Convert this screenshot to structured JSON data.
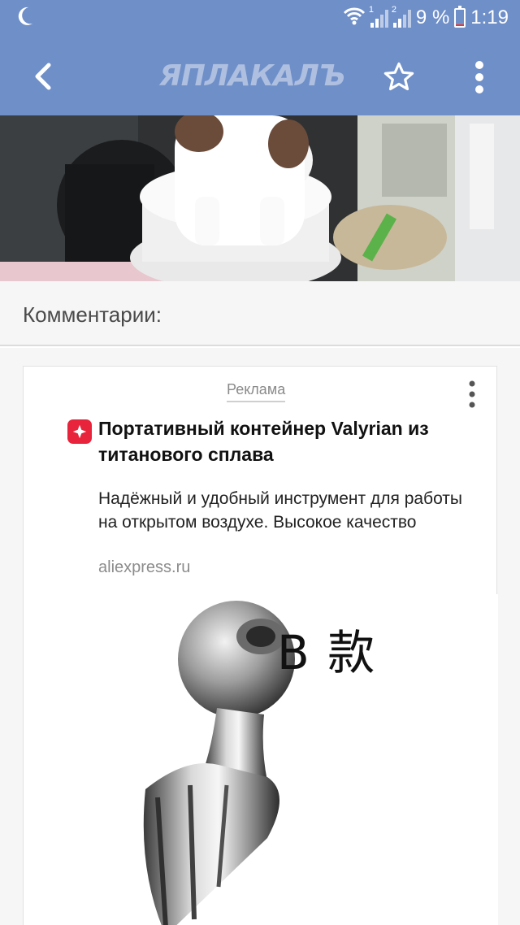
{
  "status_bar": {
    "battery_percent": "9 %",
    "battery_level": 0.09,
    "time": "1:19",
    "sim1_label": "1",
    "sim2_label": "2",
    "icons": [
      "moon-icon",
      "wifi-icon",
      "signal-icon",
      "battery-icon"
    ]
  },
  "app_bar": {
    "logo_text": "ЯПЛАКАЛЪ",
    "icons": [
      "back-arrow-icon",
      "star-icon",
      "more-vert-icon"
    ],
    "color": "#6f8fc9"
  },
  "comments": {
    "title": "Комментарии:"
  },
  "ad": {
    "label": "Реклама",
    "title": "Портативный контейнер Valyrian из титанового сплава",
    "description": "Надёжный и удобный инструмент для работы на открытом воздухе. Высокое качество",
    "domain": "aliexpress.ru",
    "image_caption": "B 款",
    "favicon_color": "#e8243c"
  }
}
